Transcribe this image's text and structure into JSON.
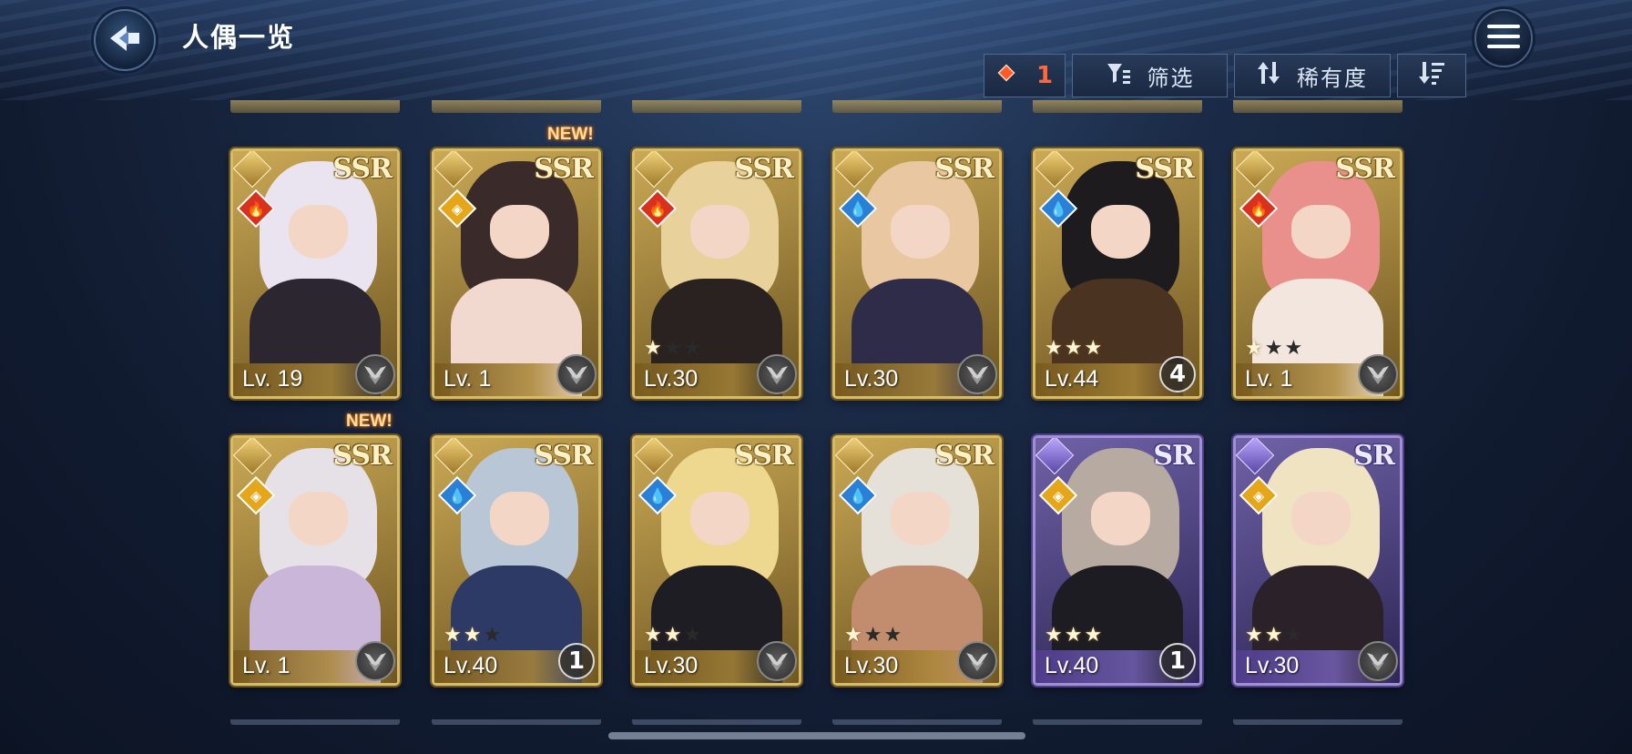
{
  "header": {
    "title": "人偶一览",
    "back_icon": "back-arrow-icon",
    "menu_icon": "hamburger-menu-icon"
  },
  "toolbar": {
    "gem_count": "1",
    "filter_label": "筛选",
    "sort_label": "稀有度",
    "order_icon": "sort-descending-icon"
  },
  "colors": {
    "ssr_frame": "#d7bc63",
    "sr_frame": "#a18ed6",
    "fire": "#d8321f",
    "water": "#2a7fd6",
    "light": "#e6a61a",
    "gem": "#ff6a3c"
  },
  "cards": [
    {
      "rarity": "SSR",
      "element": "fire",
      "level": "Lv. 19",
      "stars": 0,
      "dup": "",
      "new": "",
      "art": [
        "#e9e4f0",
        "#2b2630"
      ]
    },
    {
      "rarity": "SSR",
      "element": "light",
      "level": "Lv. 1",
      "stars": 0,
      "dup": "",
      "new": "NEW!",
      "art": [
        "#3b2a2a",
        "#f2d9d0"
      ]
    },
    {
      "rarity": "SSR",
      "element": "fire",
      "level": "Lv.30",
      "stars": 1,
      "dup": "",
      "new": "",
      "art": [
        "#e8d19a",
        "#2a2220"
      ]
    },
    {
      "rarity": "SSR",
      "element": "water",
      "level": "Lv.30",
      "stars": 0,
      "dup": "",
      "new": "",
      "art": [
        "#e9c7a0",
        "#2f2c4a"
      ]
    },
    {
      "rarity": "SSR",
      "element": "water",
      "level": "Lv.44",
      "stars": 3,
      "dup": "4",
      "new": "",
      "art": [
        "#1e1b1e",
        "#4a3320"
      ]
    },
    {
      "rarity": "SSR",
      "element": "fire",
      "level": "Lv. 1",
      "stars": 1,
      "dup": "",
      "new": "",
      "art": [
        "#e98f8c",
        "#f3e6de"
      ]
    },
    {
      "rarity": "SSR",
      "element": "light",
      "level": "Lv. 1",
      "stars": 0,
      "dup": "",
      "new": "NEW!",
      "art": [
        "#e6e1e6",
        "#c9b6d9"
      ]
    },
    {
      "rarity": "SSR",
      "element": "water",
      "level": "Lv.40",
      "stars": 2,
      "dup": "1",
      "new": "",
      "art": [
        "#b9c6d6",
        "#2d3a66"
      ]
    },
    {
      "rarity": "SSR",
      "element": "water",
      "level": "Lv.30",
      "stars": 2,
      "dup": "",
      "new": "",
      "art": [
        "#eed78f",
        "#1e1d24"
      ]
    },
    {
      "rarity": "SSR",
      "element": "water",
      "level": "Lv.30",
      "stars": 1,
      "dup": "",
      "new": "",
      "art": [
        "#e6e1d8",
        "#c28d6e"
      ]
    },
    {
      "rarity": "SR",
      "element": "light",
      "level": "Lv.40",
      "stars": 3,
      "dup": "1",
      "new": "",
      "art": [
        "#b7aaa0",
        "#1d1c22"
      ]
    },
    {
      "rarity": "SR",
      "element": "light",
      "level": "Lv.30",
      "stars": 2,
      "dup": "",
      "new": "",
      "art": [
        "#efe3c2",
        "#2a2228"
      ]
    }
  ]
}
